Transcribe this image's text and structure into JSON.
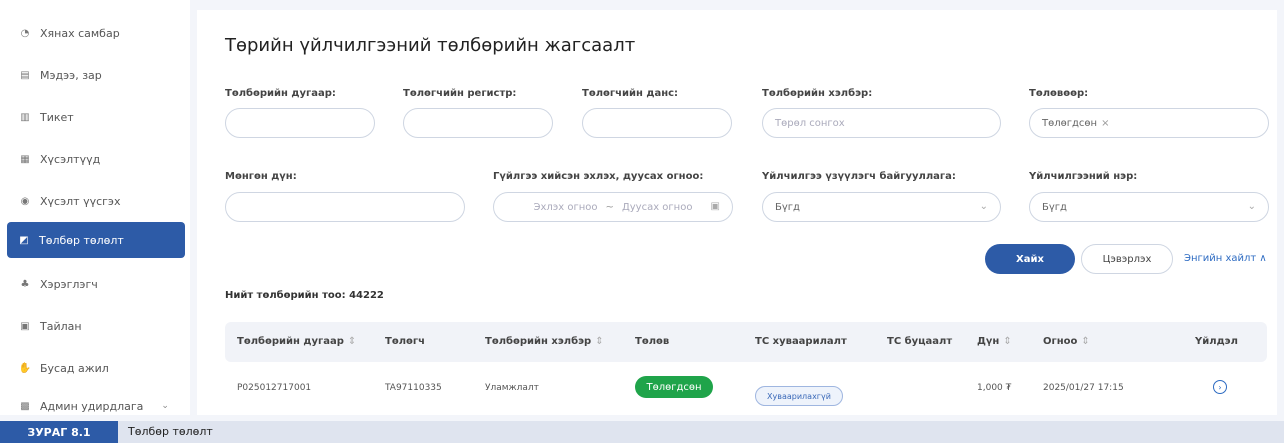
{
  "sidebar": {
    "items": [
      {
        "label": "Хянах самбар",
        "icon": "dashboard-icon",
        "glyph": "◔"
      },
      {
        "label": "Мэдээ, зар",
        "icon": "news-icon",
        "glyph": "▤"
      },
      {
        "label": "Тикет",
        "icon": "ticket-icon",
        "glyph": "▥"
      },
      {
        "label": "Хүсэлтүүд",
        "icon": "requests-icon",
        "glyph": "▦"
      },
      {
        "label": "Хүсэлт үүсгэх",
        "icon": "create-request-icon",
        "glyph": "◉"
      },
      {
        "label": "Төлбөр төлөлт",
        "icon": "payment-icon",
        "glyph": "◩"
      },
      {
        "label": "Хэрэглэгч",
        "icon": "user-icon",
        "glyph": "♣"
      },
      {
        "label": "Тайлан",
        "icon": "report-icon",
        "glyph": "▣"
      },
      {
        "label": "Бусад ажил",
        "icon": "other-work-icon",
        "glyph": "✋"
      },
      {
        "label": "Админ удирдлага",
        "icon": "admin-icon",
        "glyph": "▩",
        "chevron": "⌄"
      }
    ]
  },
  "page": {
    "title": "Төрийн үйлчилгээний төлбөрийн жагсаалт"
  },
  "filters": {
    "payment_number": {
      "label": "Төлбөрийн дугаар:",
      "value": ""
    },
    "payer_register": {
      "label": "Төлөгчийн регистр:",
      "value": ""
    },
    "payer_account": {
      "label": "Төлөгчийн данс:",
      "value": ""
    },
    "payment_type": {
      "label": "Төлбөрийн хэлбэр:",
      "placeholder": "Төрөл сонгох"
    },
    "status": {
      "label": "Төлөвөөр:",
      "value": "Төлөгдсөн",
      "remove": "×"
    },
    "amount": {
      "label": "Мөнгөн дүн:",
      "value": ""
    },
    "date_range": {
      "label": "Гүйлгээ хийсэн эхлэх, дуусах огноо:",
      "start_placeholder": "Эхлэх огноо",
      "separator": "~",
      "end_placeholder": "Дуусах огноо",
      "icon": "calendar-icon"
    },
    "provider_org": {
      "label": "Үйлчилгээ үзүүлэгч байгууллага:",
      "value": "Бүгд",
      "icon": "chevron-down-icon"
    },
    "service_name": {
      "label": "Үйлчилгээний нэр:",
      "value": "Бүгд",
      "icon": "chevron-down-icon"
    }
  },
  "actions": {
    "search": "Хайх",
    "clear": "Цэвэрлэх",
    "simple_search": "Энгийн хайлт ∧"
  },
  "summary": {
    "total_label": "Нийт төлбөрийн тоо: 44222"
  },
  "table": {
    "columns": [
      "Төлбөрийн дугаар",
      "Төлөгч",
      "Төлбөрийн хэлбэр",
      "Төлөв",
      "ТС хуваарилалт",
      "ТС буцаалт",
      "Дүн",
      "Огноо",
      "Үйлдэл"
    ],
    "sort_glyph": "⇕",
    "rows": [
      {
        "payment_number": "P025012717001",
        "payer": "TA97110335",
        "payment_type": "Уламжлалт",
        "status": "Төлөгдсөн",
        "allocation": "Хуваарилахгүй",
        "refund": "",
        "amount": "1,000 ₮",
        "date": "2025/01/27 17:15",
        "action_icon": "view-icon"
      }
    ]
  },
  "caption": {
    "figure": "ЗУРАГ 8.1",
    "text": "Төлбөр төлөлт"
  },
  "colors": {
    "primary": "#2d5ba7",
    "success": "#1fa44a",
    "background": "#f3f5fa"
  }
}
